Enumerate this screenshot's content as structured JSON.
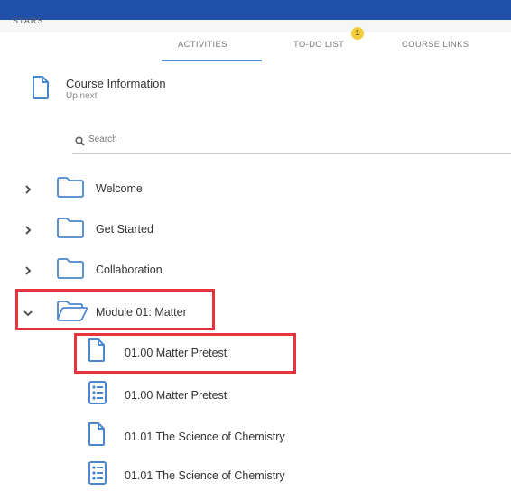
{
  "topbar": {
    "cut_text": "STARS"
  },
  "tabs": [
    {
      "label": "ACTIVITIES",
      "active": true
    },
    {
      "label": "TO-DO LIST",
      "badge": "1"
    },
    {
      "label": "COURSE LINKS"
    }
  ],
  "course_info": {
    "title": "Course Information",
    "subtitle": "Up next"
  },
  "search": {
    "placeholder": "Search"
  },
  "folders": [
    {
      "label": "Welcome",
      "expanded": false
    },
    {
      "label": "Get Started",
      "expanded": false
    },
    {
      "label": "Collaboration",
      "expanded": false
    },
    {
      "label": "Module 01: Matter",
      "expanded": true
    }
  ],
  "module_items": [
    {
      "label": "01.00 Matter Pretest",
      "icon": "document-icon"
    },
    {
      "label": "01.00 Matter Pretest",
      "icon": "quiz-list-icon"
    },
    {
      "label": "01.01 The Science of Chemistry",
      "icon": "document-icon"
    },
    {
      "label": "01.01 The Science of Chemistry",
      "icon": "quiz-list-icon"
    }
  ],
  "colors": {
    "topbar": "#1f4fa8",
    "accent": "#4b87cc",
    "badge": "#f4cc3a",
    "highlight": "#e8343f"
  }
}
